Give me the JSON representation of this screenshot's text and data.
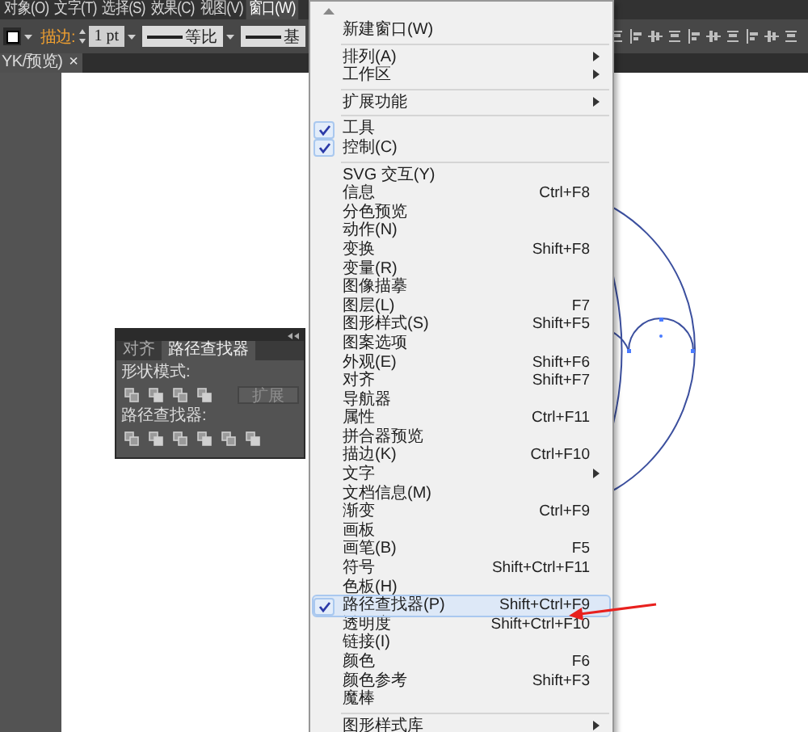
{
  "menubar": [
    {
      "label": "对象(O)",
      "selected": false
    },
    {
      "label": "文字(T)",
      "selected": false
    },
    {
      "label": "选择(S)",
      "selected": false
    },
    {
      "label": "效果(C)",
      "selected": false
    },
    {
      "label": "视图(V)",
      "selected": false
    },
    {
      "label": "窗口(W)",
      "selected": true
    }
  ],
  "control_bar": {
    "stroke_label": "描边:",
    "stroke_weight": "1 pt",
    "stroke_profile": "等比",
    "brush": "基"
  },
  "document_tab": {
    "title": "YK/预览)",
    "close": "×"
  },
  "panel": {
    "tabs": [
      {
        "label": "对齐",
        "selected": false
      },
      {
        "label": "路径查找器",
        "selected": true
      }
    ],
    "shape_modes_label": "形状模式:",
    "expand_button": {
      "label": "扩展",
      "disabled": true
    },
    "pathfinders_label": "路径查找器:"
  },
  "window_menu": {
    "items": [
      {
        "kind": "item",
        "label": "新建窗口(W)",
        "checked": false,
        "selected": false,
        "submenu": false
      },
      {
        "kind": "separator"
      },
      {
        "kind": "item",
        "label": "排列(A)",
        "checked": false,
        "selected": false,
        "submenu": true
      },
      {
        "kind": "item",
        "label": "工作区",
        "checked": false,
        "selected": false,
        "submenu": true
      },
      {
        "kind": "separator"
      },
      {
        "kind": "item",
        "label": "扩展功能",
        "checked": false,
        "selected": false,
        "submenu": true
      },
      {
        "kind": "separator"
      },
      {
        "kind": "item",
        "label": "工具",
        "checked": true,
        "selected": false,
        "submenu": false
      },
      {
        "kind": "item",
        "label": "控制(C)",
        "checked": true,
        "selected": false,
        "submenu": false
      },
      {
        "kind": "separator"
      },
      {
        "kind": "item",
        "label": "SVG 交互(Y)",
        "checked": false,
        "selected": false,
        "submenu": false
      },
      {
        "kind": "item",
        "label": "信息",
        "shortcut": "Ctrl+F8",
        "checked": false,
        "selected": false,
        "submenu": false
      },
      {
        "kind": "item",
        "label": "分色预览",
        "checked": false,
        "selected": false,
        "submenu": false
      },
      {
        "kind": "item",
        "label": "动作(N)",
        "checked": false,
        "selected": false,
        "submenu": false
      },
      {
        "kind": "item",
        "label": "变换",
        "shortcut": "Shift+F8",
        "checked": false,
        "selected": false,
        "submenu": false
      },
      {
        "kind": "item",
        "label": "变量(R)",
        "checked": false,
        "selected": false,
        "submenu": false
      },
      {
        "kind": "item",
        "label": "图像描摹",
        "checked": false,
        "selected": false,
        "submenu": false
      },
      {
        "kind": "item",
        "label": "图层(L)",
        "shortcut": "F7",
        "checked": false,
        "selected": false,
        "submenu": false
      },
      {
        "kind": "item",
        "label": "图形样式(S)",
        "shortcut": "Shift+F5",
        "checked": false,
        "selected": false,
        "submenu": false
      },
      {
        "kind": "item",
        "label": "图案选项",
        "checked": false,
        "selected": false,
        "submenu": false
      },
      {
        "kind": "item",
        "label": "外观(E)",
        "shortcut": "Shift+F6",
        "checked": false,
        "selected": false,
        "submenu": false
      },
      {
        "kind": "item",
        "label": "对齐",
        "shortcut": "Shift+F7",
        "checked": false,
        "selected": false,
        "submenu": false
      },
      {
        "kind": "item",
        "label": "导航器",
        "checked": false,
        "selected": false,
        "submenu": false
      },
      {
        "kind": "item",
        "label": "属性",
        "shortcut": "Ctrl+F11",
        "checked": false,
        "selected": false,
        "submenu": false
      },
      {
        "kind": "item",
        "label": "拼合器预览",
        "checked": false,
        "selected": false,
        "submenu": false
      },
      {
        "kind": "item",
        "label": "描边(K)",
        "shortcut": "Ctrl+F10",
        "checked": false,
        "selected": false,
        "submenu": false
      },
      {
        "kind": "item",
        "label": "文字",
        "checked": false,
        "selected": false,
        "submenu": true
      },
      {
        "kind": "item",
        "label": "文档信息(M)",
        "checked": false,
        "selected": false,
        "submenu": false
      },
      {
        "kind": "item",
        "label": "渐变",
        "shortcut": "Ctrl+F9",
        "checked": false,
        "selected": false,
        "submenu": false
      },
      {
        "kind": "item",
        "label": "画板",
        "checked": false,
        "selected": false,
        "submenu": false
      },
      {
        "kind": "item",
        "label": "画笔(B)",
        "shortcut": "F5",
        "checked": false,
        "selected": false,
        "submenu": false
      },
      {
        "kind": "item",
        "label": "符号",
        "shortcut": "Shift+Ctrl+F11",
        "checked": false,
        "selected": false,
        "submenu": false
      },
      {
        "kind": "item",
        "label": "色板(H)",
        "checked": false,
        "selected": false,
        "submenu": false
      },
      {
        "kind": "item",
        "label": "路径查找器(P)",
        "shortcut": "Shift+Ctrl+F9",
        "checked": true,
        "selected": true,
        "submenu": false
      },
      {
        "kind": "item",
        "label": "透明度",
        "shortcut": "Shift+Ctrl+F10",
        "checked": false,
        "selected": false,
        "submenu": false
      },
      {
        "kind": "item",
        "label": "链接(I)",
        "checked": false,
        "selected": false,
        "submenu": false
      },
      {
        "kind": "item",
        "label": "颜色",
        "shortcut": "F6",
        "checked": false,
        "selected": false,
        "submenu": false
      },
      {
        "kind": "item",
        "label": "颜色参考",
        "shortcut": "Shift+F3",
        "checked": false,
        "selected": false,
        "submenu": false
      },
      {
        "kind": "item",
        "label": "魔棒",
        "checked": false,
        "selected": false,
        "submenu": false
      },
      {
        "kind": "separator"
      },
      {
        "kind": "item",
        "label": "图形样式库",
        "checked": false,
        "selected": false,
        "submenu": true
      }
    ]
  }
}
